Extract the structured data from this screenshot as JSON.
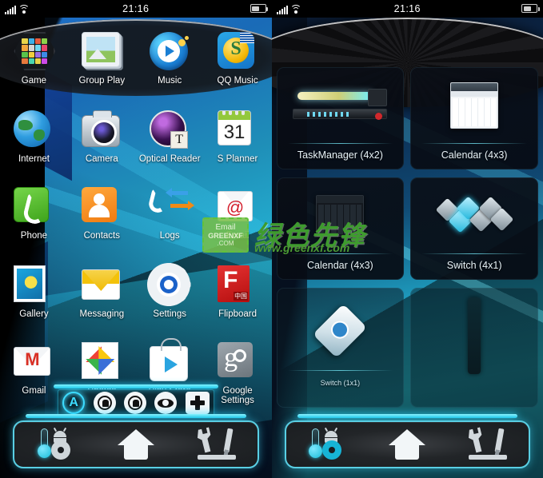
{
  "status_bar": {
    "time": "21:16",
    "signal_icon": "signal-bars-icon",
    "wifi_icon": "wifi-icon",
    "battery_icon": "battery-icon"
  },
  "left_panel": {
    "title": "app-drawer",
    "apps": [
      [
        {
          "label": "Game",
          "icon": "game-hub-icon"
        },
        {
          "label": "Group Play",
          "icon": "group-play-icon"
        },
        {
          "label": "Music",
          "icon": "music-icon"
        },
        {
          "label": "QQ Music",
          "icon": "qq-music-icon"
        }
      ],
      [
        {
          "label": "Internet",
          "icon": "internet-globe-icon"
        },
        {
          "label": "Camera",
          "icon": "camera-icon"
        },
        {
          "label": "Optical Reader",
          "icon": "optical-reader-icon"
        },
        {
          "label": "S Planner",
          "icon": "s-planner-icon",
          "day": "31"
        }
      ],
      [
        {
          "label": "Phone",
          "icon": "phone-icon"
        },
        {
          "label": "Contacts",
          "icon": "contacts-icon"
        },
        {
          "label": "Logs",
          "icon": "call-logs-icon"
        },
        {
          "label": "Email",
          "icon": "email-icon"
        }
      ],
      [
        {
          "label": "Gallery",
          "icon": "gallery-icon"
        },
        {
          "label": "Messaging",
          "icon": "messaging-icon"
        },
        {
          "label": "Settings",
          "icon": "settings-gear-icon"
        },
        {
          "label": "Flipboard",
          "icon": "flipboard-icon",
          "badge": "中国"
        }
      ],
      [
        {
          "label": "Gmail",
          "icon": "gmail-icon"
        },
        {
          "label": "Photos",
          "icon": "photos-icon"
        },
        {
          "label": "Play Store",
          "icon": "play-store-icon"
        },
        {
          "label": "Google Settings",
          "icon": "google-settings-icon"
        }
      ]
    ],
    "edit_toolbar": {
      "buttons": [
        {
          "name": "auto-mode-button",
          "icon": "circled-a-icon",
          "active": true
        },
        {
          "name": "drag-down-button",
          "icon": "hand-drag-down-icon",
          "active": false
        },
        {
          "name": "drag-up-button",
          "icon": "hand-drag-up-icon",
          "active": false
        },
        {
          "name": "preview-button",
          "icon": "eye-icon",
          "active": false
        },
        {
          "name": "add-button",
          "icon": "plus-icon",
          "active": false
        }
      ]
    }
  },
  "right_panel": {
    "title": "widget-picker",
    "widgets": [
      [
        {
          "label": "TaskManager (4x2)",
          "thumb": "task-manager-thumb"
        },
        {
          "label": "Calendar (4x3)",
          "thumb": "calendar-light-thumb"
        }
      ],
      [
        {
          "label": "Calendar (4x3)",
          "thumb": "calendar-dark-thumb"
        },
        {
          "label": "Switch (4x1)",
          "thumb": "switch-row-thumb"
        }
      ],
      [
        {
          "label": "Switch (1x1)",
          "thumb": "switch-single-thumb"
        },
        {
          "label": "",
          "thumb": "widget-partial-thumb"
        }
      ]
    ]
  },
  "nav_bar": {
    "items": [
      {
        "name": "android-settings-button",
        "icon": "android-thermometer-gear-icon"
      },
      {
        "name": "home-button",
        "icon": "home-icon"
      },
      {
        "name": "tools-button",
        "icon": "wrench-screwdriver-icon"
      }
    ]
  },
  "watermark": {
    "logo_line1": "Email",
    "logo_line2": "GREENXF",
    "logo_line3": ".COM",
    "brand": "绿色先锋",
    "url": "www.greenxf.com"
  },
  "colors": {
    "accent_cyan": "#2fd8ff",
    "wallpaper_blue": "#1a6bb7",
    "nav_dark": "#1a1d20",
    "watermark_green": "#3e9b2e"
  }
}
